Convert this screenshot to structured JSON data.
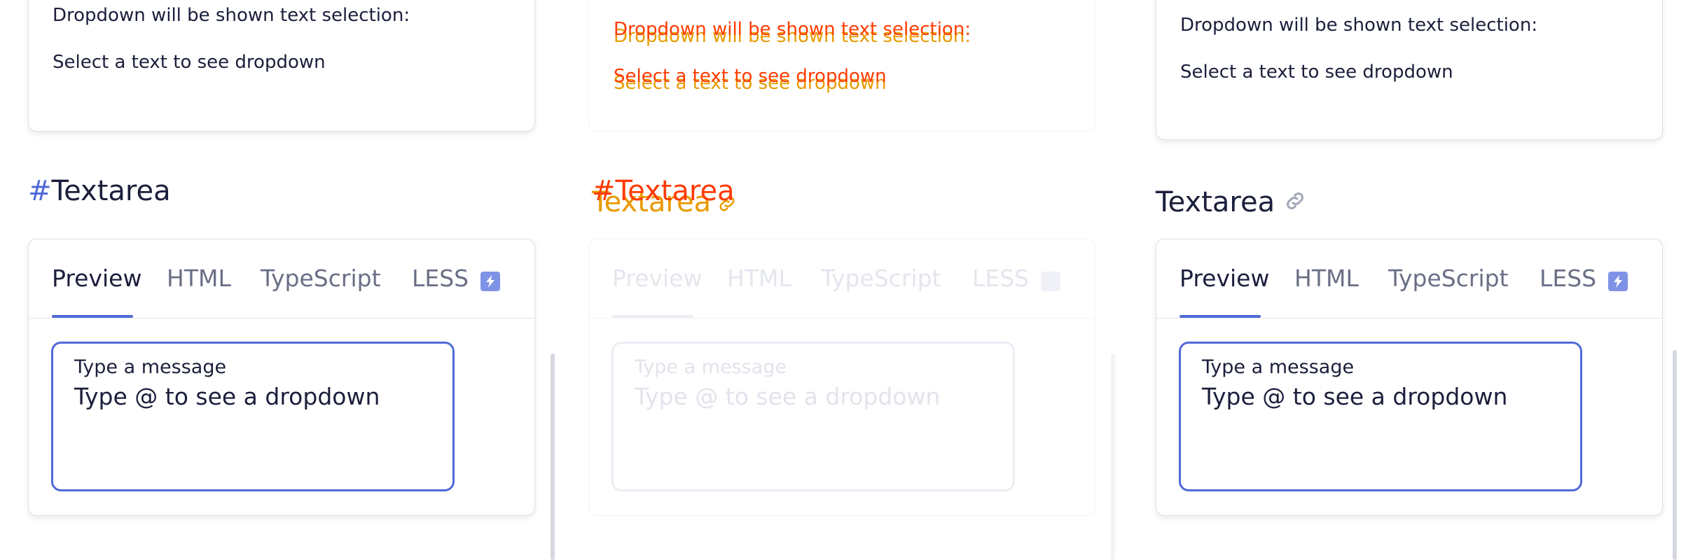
{
  "selection_demo": {
    "line1": "Dropdown will be shown text selection:",
    "line2": "Select a text to see dropdown"
  },
  "section": {
    "hash": "#",
    "title": "Textarea"
  },
  "tabs": [
    "Preview",
    "HTML",
    "TypeScript",
    "LESS"
  ],
  "textarea": {
    "label": "Type a message",
    "value": "Type @ to see a dropdown"
  },
  "icons": {
    "stackblitz": "bolt-icon",
    "anchor": "link-icon"
  },
  "colors": {
    "accent": "#4f6ad8",
    "text": "#1b1f3b",
    "diff_red": "#ff3b00",
    "diff_orange": "#e89a00"
  }
}
